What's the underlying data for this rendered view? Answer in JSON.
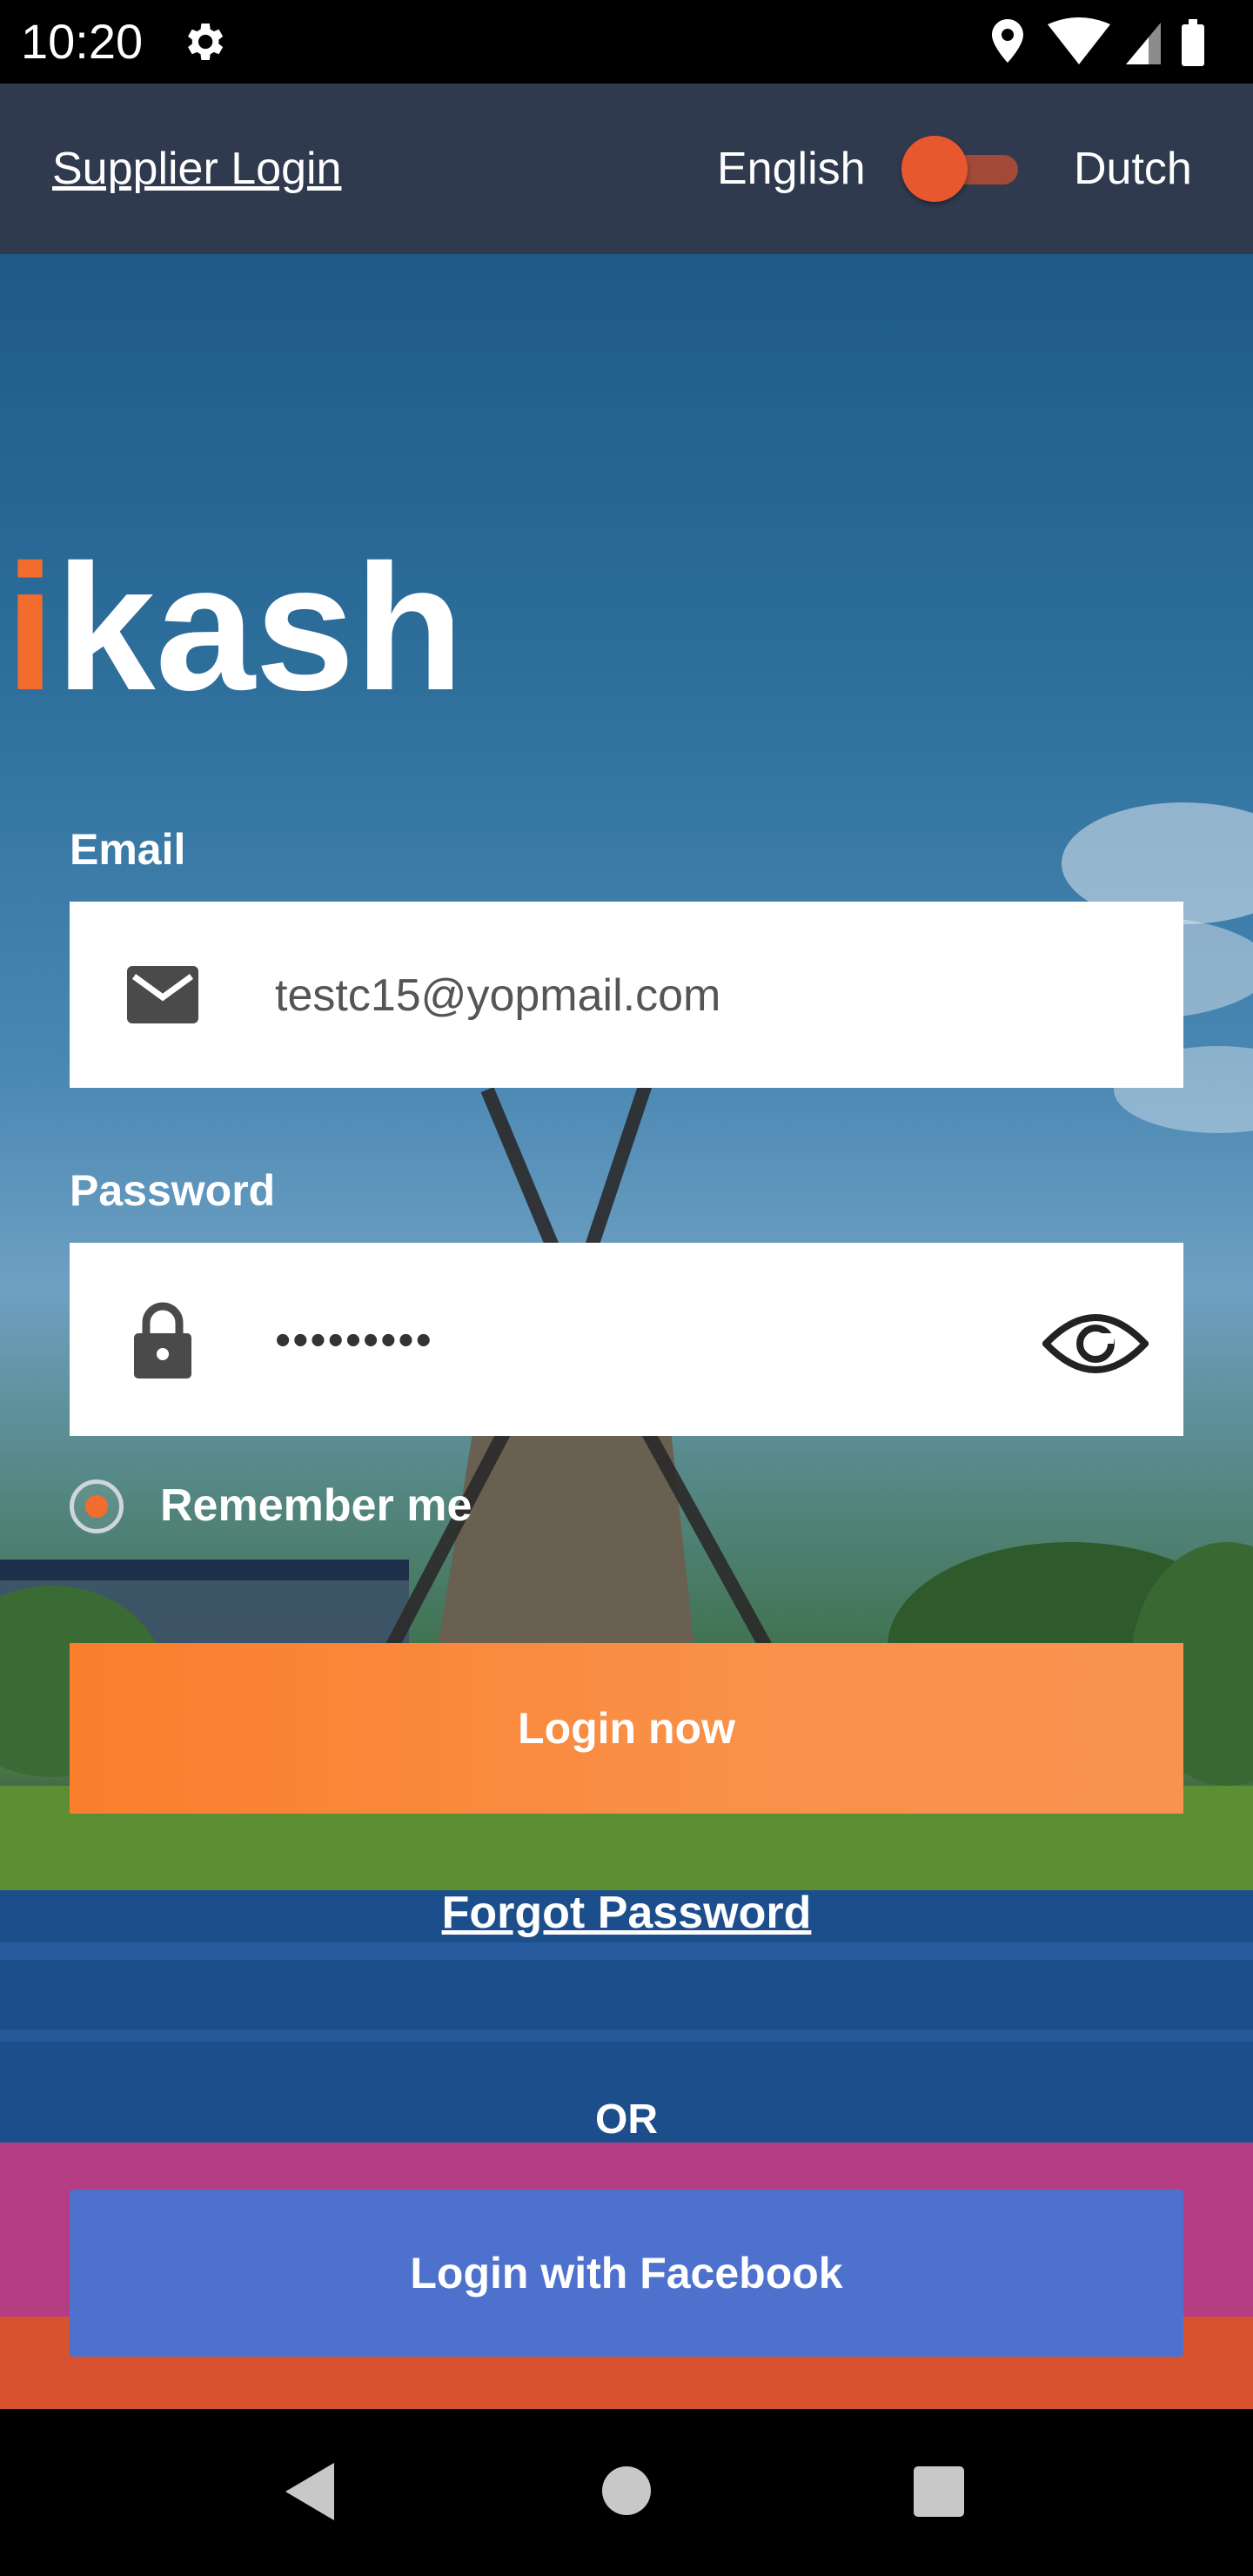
{
  "status_bar": {
    "time": "10:20"
  },
  "top_bar": {
    "supplier_login": "Supplier Login",
    "lang_left": "English",
    "lang_right": "Dutch"
  },
  "logo": {
    "text_accent": "i",
    "text_main": "kash",
    "accent_color": "#f26d2d"
  },
  "form": {
    "email_label": "Email",
    "email_value": "testc15@yopmail.com",
    "password_label": "Password",
    "password_value": "•••••••••",
    "remember_label": "Remember me"
  },
  "actions": {
    "login": "Login now",
    "forgot": "Forgot Password",
    "or": "OR",
    "facebook": "Login with Facebook"
  },
  "colors": {
    "top_bar": "#303a4f",
    "login_button": "#fa7e2c",
    "facebook_button": "#4e71cd",
    "toggle_thumb": "#e8582f"
  }
}
